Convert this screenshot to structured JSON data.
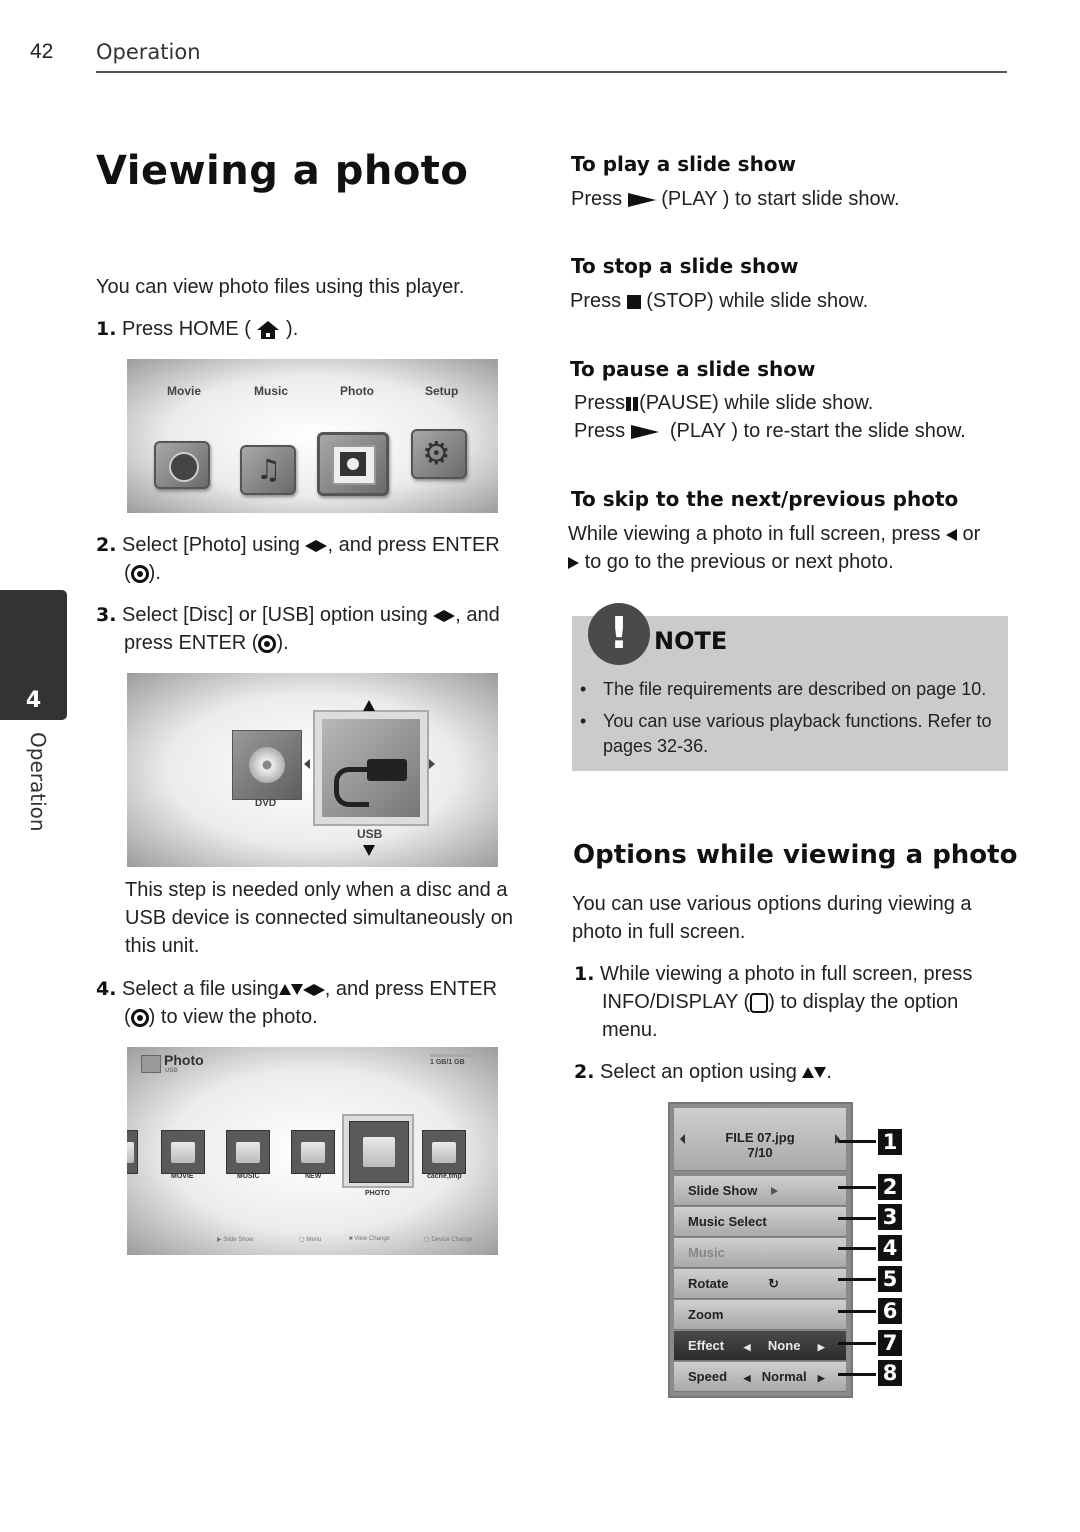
{
  "header": {
    "page_number": "42",
    "section": "Operation"
  },
  "title": "Viewing a photo",
  "side_tab": {
    "chapter_number": "4",
    "label": "Operation"
  },
  "left_column": {
    "intro": "You can view photo files using this player.",
    "step1": {
      "num": "1.",
      "text_before": "Press HOME (",
      "icon": "home-icon",
      "text_after": ")."
    },
    "home_screen": {
      "items": [
        "Movie",
        "Music",
        "Photo",
        "Setup"
      ]
    },
    "step2": {
      "num": "2.",
      "text_before": "Select [Photo] using",
      "text_after": ", and press ENTER",
      "line2_before": "(",
      "line2_after": ")."
    },
    "step3": {
      "num": "3.",
      "text_before": "Select [Disc] or [USB] option using",
      "text_after": ", and",
      "line2_before": "press ENTER (",
      "line2_after": ")."
    },
    "device_screen": {
      "left_label": "DVD",
      "selected_label": "USB"
    },
    "step3_note": [
      "This step is needed only when a disc and a",
      "USB device is connected simultaneously on",
      "this unit."
    ],
    "step4": {
      "num": "4.",
      "text_before": "Select a file using",
      "text_after": ", and press ENTER",
      "line2_before": "(",
      "line2_after": ") to view the photo."
    },
    "file_screen": {
      "title": "Photo",
      "subtitle": "USB",
      "capacity": "1 GB/1 GB",
      "folders": [
        "MOVIE",
        "MUSIC",
        "NEW",
        "PHOTO",
        "cache,tmp"
      ],
      "selected_folder": "PHOTO",
      "footer": [
        "Slide Show",
        "Menu",
        "View Change",
        "Device Change"
      ]
    }
  },
  "right_column": {
    "sections": [
      {
        "heading": "To play a slide show",
        "lines": [
          {
            "before": "Press",
            "icon": "play",
            "after": "(PLAY ) to start slide show."
          }
        ]
      },
      {
        "heading": "To stop a slide show",
        "lines": [
          {
            "before": "Press",
            "icon": "stop",
            "after": "(STOP) while slide show."
          }
        ]
      },
      {
        "heading": "To pause a slide show",
        "lines": [
          {
            "before": "Press",
            "icon": "pause",
            "after": "(PAUSE) while slide show."
          },
          {
            "before": "Press",
            "icon": "play",
            "after": "(PLAY ) to re-start the slide show."
          }
        ]
      },
      {
        "heading": "To skip to the next/previous photo",
        "lines": [
          {
            "before": "While viewing a photo in full screen, press",
            "after": "or"
          },
          {
            "before": "",
            "after": "to go to the previous or next photo."
          }
        ]
      }
    ],
    "note": {
      "title": "NOTE",
      "items": [
        "The file requirements are described on page 10.",
        "You can use various playback functions. Refer to pages 32-36."
      ]
    },
    "options": {
      "heading": "Options while viewing a photo",
      "intro": [
        "You can use various options during viewing a",
        "photo in full screen."
      ],
      "step1": {
        "num": "1.",
        "line1": "While viewing a photo in full screen, press",
        "line2_before": "INFO/DISPLAY (",
        "line2_after": ") to display the option",
        "line3": "menu."
      },
      "step2": {
        "num": "2.",
        "text": "Select an option using",
        "after": "."
      },
      "menu": {
        "file_name": "FILE 07.jpg",
        "file_index": "7/10",
        "rows": [
          {
            "label": "Slide Show",
            "value": ""
          },
          {
            "label": "Music Select",
            "value": ""
          },
          {
            "label": "Music",
            "value": ""
          },
          {
            "label": "Rotate",
            "value": ""
          },
          {
            "label": "Zoom",
            "value": ""
          },
          {
            "label": "Effect",
            "value": "None"
          },
          {
            "label": "Speed",
            "value": "Normal"
          }
        ],
        "callouts": [
          "1",
          "2",
          "3",
          "4",
          "5",
          "6",
          "7",
          "8"
        ]
      }
    }
  }
}
